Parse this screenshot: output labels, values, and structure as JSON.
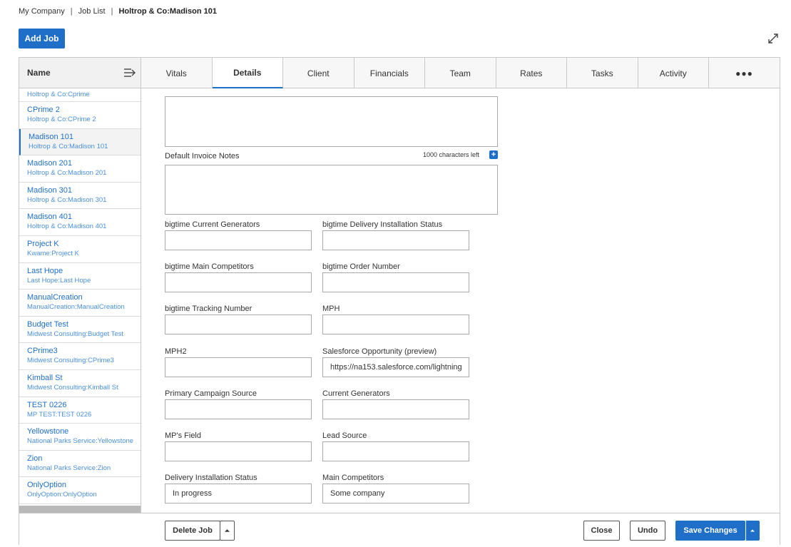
{
  "breadcrumb": {
    "items": [
      "My Company",
      "Job List"
    ],
    "separator": "|",
    "current": "Holtrop & Co:Madison 101"
  },
  "actions": {
    "add_job": "Add Job"
  },
  "sidebar": {
    "header": "Name",
    "partial_item_sub": "Holtrop & Co:Cprime",
    "items": [
      {
        "name": "CPrime 2",
        "sub": "Holtrop & Co:CPrime 2"
      },
      {
        "name": "Madison 101",
        "sub": "Holtrop & Co:Madison 101",
        "selected": true
      },
      {
        "name": "Madison 201",
        "sub": "Holtrop & Co:Madison 201"
      },
      {
        "name": "Madison 301",
        "sub": "Holtrop & Co:Madison 301"
      },
      {
        "name": "Madison 401",
        "sub": "Holtrop & Co:Madison 401"
      },
      {
        "name": "Project K",
        "sub": "Kwame:Project K"
      },
      {
        "name": "Last Hope",
        "sub": "Last Hope:Last Hope"
      },
      {
        "name": "ManualCreation",
        "sub": "ManualCreation:ManualCreation"
      },
      {
        "name": "Budget Test",
        "sub": "Midwest Consulting:Budget Test"
      },
      {
        "name": "CPrime3",
        "sub": "Midwest Consulting:CPrime3"
      },
      {
        "name": "Kimball St",
        "sub": "Midwest Consulting:Kimball St"
      },
      {
        "name": "TEST 0226",
        "sub": "MP TEST:TEST 0226"
      },
      {
        "name": "Yellowstone",
        "sub": "National Parks Service:Yellowstone"
      },
      {
        "name": "Zion",
        "sub": "National Parks Service:Zion"
      },
      {
        "name": "OnlyOption",
        "sub": "OnlyOption:OnlyOption"
      }
    ]
  },
  "tabs": [
    "Vitals",
    "Details",
    "Client",
    "Financials",
    "Team",
    "Rates",
    "Tasks",
    "Activity",
    "●●●"
  ],
  "active_tab": "Details",
  "form": {
    "invoice_notes_label": "Default Invoice Notes",
    "chars_left": "1000 characters left",
    "fields": [
      {
        "label": "bigtime Current Generators",
        "value": ""
      },
      {
        "label": "bigtime Delivery Installation Status",
        "value": ""
      },
      {
        "label": "bigtime Main Competitors",
        "value": ""
      },
      {
        "label": "bigtime Order Number",
        "value": ""
      },
      {
        "label": "bigtime Tracking Number",
        "value": ""
      },
      {
        "label": "MPH",
        "value": ""
      },
      {
        "label": "MPH2",
        "value": ""
      },
      {
        "label": "Salesforce Opportunity (preview)",
        "value": "https://na153.salesforce.com/lightning"
      },
      {
        "label": "Primary Campaign Source",
        "value": ""
      },
      {
        "label": "Current Generators",
        "value": ""
      },
      {
        "label": "MP's Field",
        "value": ""
      },
      {
        "label": "Lead Source",
        "value": ""
      },
      {
        "label": "Delivery Installation Status",
        "value": "In progress"
      },
      {
        "label": "Main Competitors",
        "value": "Some company"
      }
    ]
  },
  "footer": {
    "delete": "Delete Job",
    "close": "Close",
    "undo": "Undo",
    "save": "Save Changes"
  },
  "colors": {
    "accent": "#1f6fc9",
    "link": "#1f6fc9"
  }
}
